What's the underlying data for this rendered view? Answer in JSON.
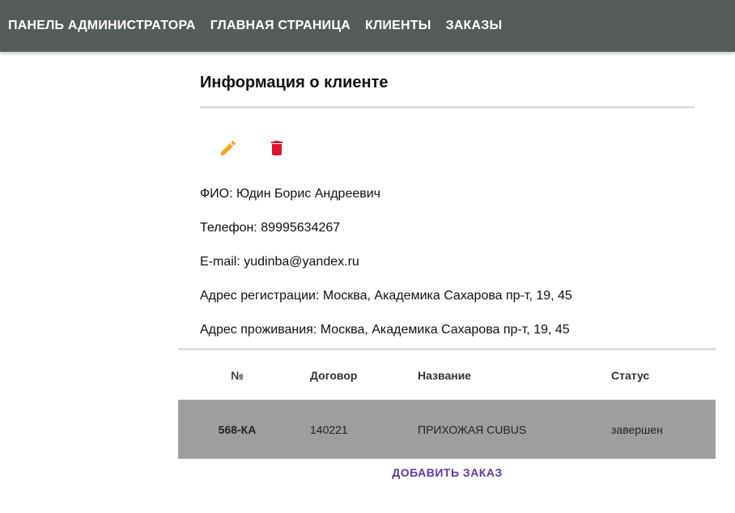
{
  "nav": {
    "items": [
      {
        "label": "ПАНЕЛЬ АДМИНИСТРАТОРА"
      },
      {
        "label": "ГЛАВНАЯ СТРАНИЦА"
      },
      {
        "label": "КЛИЕНТЫ"
      },
      {
        "label": "ЗАКАЗЫ"
      }
    ]
  },
  "client": {
    "title": "Информация о клиенте",
    "actions": {
      "edit_icon": "pencil-icon",
      "delete_icon": "trash-icon",
      "edit_color": "#f5a623",
      "delete_color": "#e0142d"
    },
    "fields": [
      {
        "label": "ФИО:",
        "value": "Юдин Борис Андреевич"
      },
      {
        "label": "Телефон:",
        "value": "89995634267"
      },
      {
        "label": "E-mail:",
        "value": "yudinba@yandex.ru"
      },
      {
        "label": "Адрес регистрации:",
        "value": "Москва, Академика Сахарова пр-т, 19, 45"
      },
      {
        "label": "Адрес проживания:",
        "value": "Москва, Академика Сахарова пр-т, 19, 45"
      }
    ]
  },
  "orders": {
    "columns": [
      "№",
      "Договор",
      "Название",
      "Статус"
    ],
    "rows": [
      {
        "num": "568-КА",
        "contract": "140221",
        "name": "Прихожая CUBUS",
        "status": "завершен"
      }
    ],
    "add_label": "Добавить заказ",
    "row_color": "#9e9e9e",
    "accent_color": "#5b3aa8"
  }
}
